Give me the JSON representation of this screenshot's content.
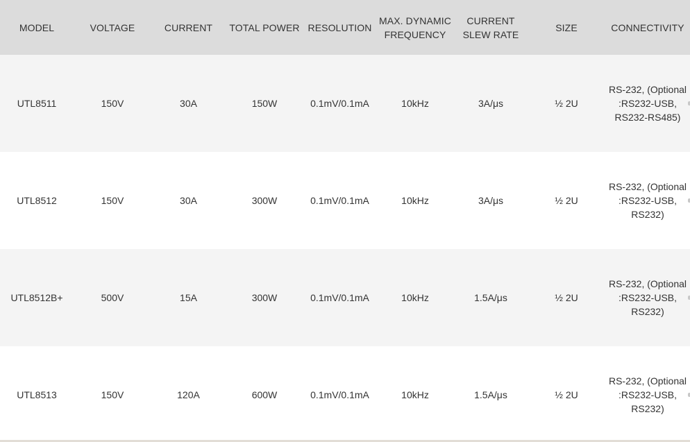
{
  "table": {
    "headers": [
      "MODEL",
      "VOLTAGE",
      "CURRENT",
      "TOTAL POWER",
      "RESOLUTION",
      "MAX. DYNAMIC FREQUENCY",
      "CURRENT SLEW RATE",
      "SIZE",
      "CONNECTIVITY"
    ],
    "rows": [
      [
        "UTL8511",
        "150V",
        "30A",
        "150W",
        "0.1mV/0.1mA",
        "10kHz",
        "3A/μs",
        "½ 2U",
        "RS-232, (Optional :RS232-USB, RS232-RS485)"
      ],
      [
        "UTL8512",
        "150V",
        "30A",
        "300W",
        "0.1mV/0.1mA",
        "10kHz",
        "3A/μs",
        "½ 2U",
        "RS-232, (Optional :RS232-USB, RS232)"
      ],
      [
        "UTL8512B+",
        "500V",
        "15A",
        "300W",
        "0.1mV/0.1mA",
        "10kHz",
        "1.5A/μs",
        "½ 2U",
        "RS-232, (Optional :RS232-USB, RS232)"
      ],
      [
        "UTL8513",
        "150V",
        "120A",
        "600W",
        "0.1mV/0.1mA",
        "10kHz",
        "1.5A/μs",
        "½ 2U",
        "RS-232, (Optional :RS232-USB, RS232)"
      ]
    ]
  },
  "colors": {
    "header_bg": "#dcdcdc",
    "row_alt_bg": "#f4f4f4",
    "row_bg": "#ffffff",
    "text": "#333333"
  }
}
